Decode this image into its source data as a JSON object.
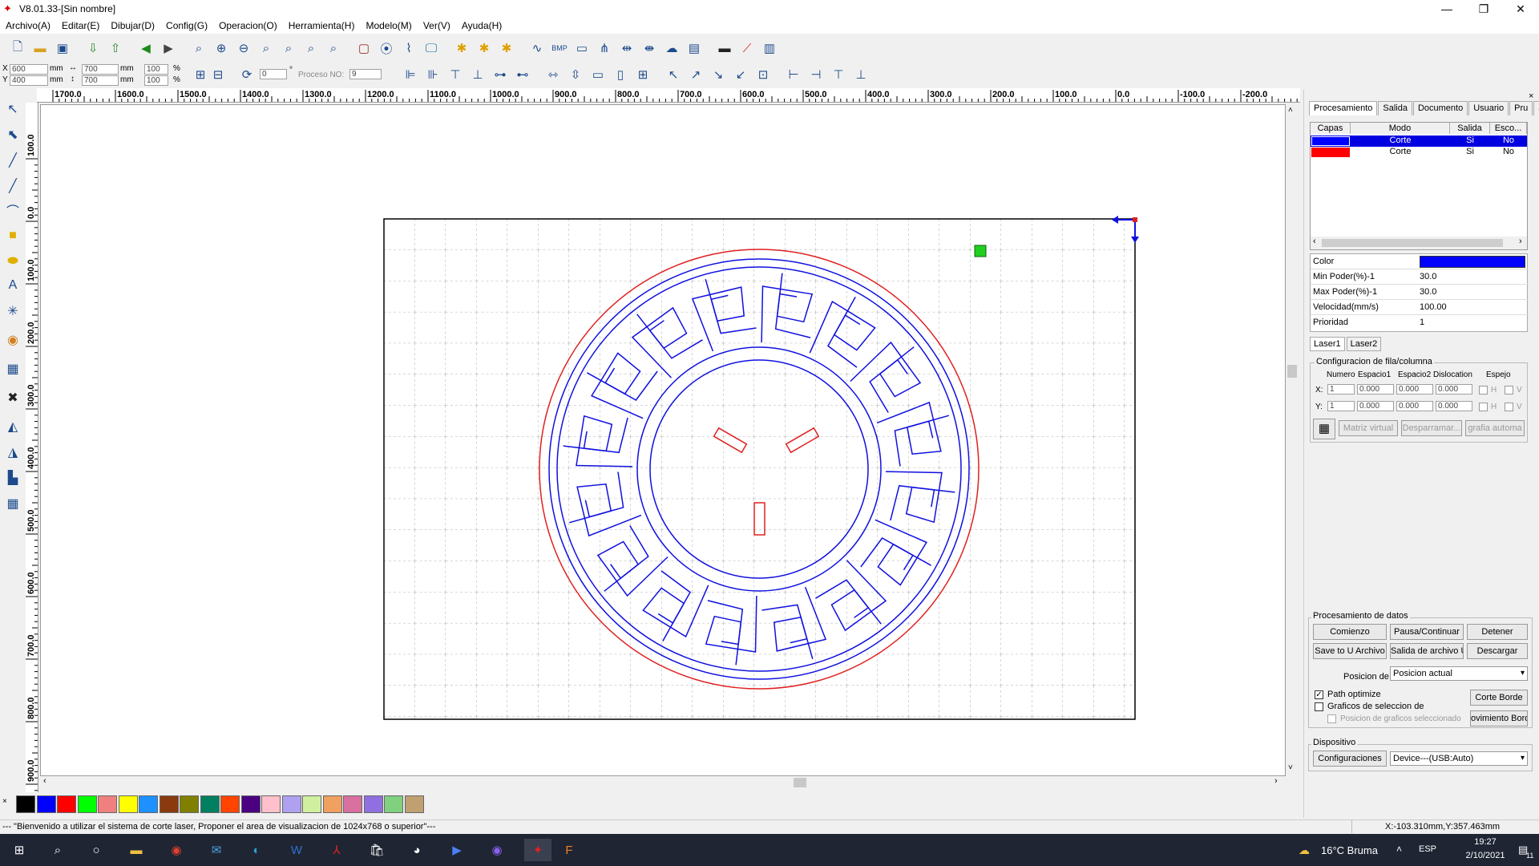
{
  "window": {
    "title": "V8.01.33-[Sin nombre]"
  },
  "menu": [
    "Archivo(A)",
    "Editar(E)",
    "Dibujar(D)",
    "Config(G)",
    "Operacion(O)",
    "Herramienta(H)",
    "Modelo(M)",
    "Ver(V)",
    "Ayuda(H)"
  ],
  "toolbar2": {
    "x": "600",
    "y": "400",
    "unit": "mm",
    "w": "700",
    "h": "700",
    "sx": "100",
    "sy": "100",
    "pct": "%",
    "rot": "0",
    "deg": "°",
    "proc_label": "Proceso NO:",
    "proc": "9"
  },
  "rulers": {
    "h": [
      "1700.0",
      "1600.0",
      "1500.0",
      "1400.0",
      "1300.0",
      "1200.0",
      "1100.0",
      "1000.0",
      "900.0",
      "800.0",
      "700.0",
      "600.0",
      "500.0",
      "400.0",
      "300.0",
      "200.0",
      "100.0",
      "0.0",
      "-100.0",
      "-200.0"
    ],
    "v": [
      "100.0",
      "0.0",
      "100.0",
      "200.0",
      "300.0",
      "400.0",
      "500.0",
      "600.0",
      "700.0",
      "800.0",
      "900.0"
    ]
  },
  "panel": {
    "tabs": [
      "Procesamiento",
      "Salida",
      "Documento",
      "Usuario",
      "Pru"
    ],
    "layer_headers": [
      "Capas",
      "Modo",
      "Salida",
      "Esco..."
    ],
    "layers": [
      {
        "color": "#0000ff",
        "mode": "Corte",
        "out": "Si",
        "esc": "No",
        "selected": true
      },
      {
        "color": "#ff0000",
        "mode": "Corte",
        "out": "Si",
        "esc": "No",
        "selected": false
      }
    ],
    "props": [
      {
        "k": "Color",
        "v": ""
      },
      {
        "k": "Min Poder(%)-1",
        "v": "30.0"
      },
      {
        "k": "Max Poder(%)-1",
        "v": "30.0"
      },
      {
        "k": "Velocidad(mm/s)",
        "v": "100.00"
      },
      {
        "k": "Prioridad",
        "v": "1"
      }
    ],
    "prop_color": "#0000ff",
    "laser_tabs": [
      "Laser1",
      "Laser2"
    ],
    "array": {
      "title": "Configuracion de fila/columna",
      "headers": [
        "Numero",
        "Espacio1",
        "Espacio2",
        "Dislocation",
        "Espejo"
      ],
      "x_label": "X:",
      "y_label": "Y:",
      "x": [
        "1",
        "0.000",
        "0.000",
        "0.000"
      ],
      "y": [
        "1",
        "0.000",
        "0.000",
        "0.000"
      ],
      "h": "H",
      "v": "V",
      "btns": [
        "Matriz virtual",
        "Desparramar...",
        "grafia automa"
      ]
    },
    "data": {
      "title": "Procesamiento de datos",
      "btns": [
        "Comienzo",
        "Pausa/Continuar",
        "Detener",
        "Save to U Archivo",
        "Salida de archivo U",
        "Descargar"
      ],
      "pos_label": "Posicion de",
      "pos_value": "Posicion actual",
      "path_opt": "Path optimize",
      "graf_sel": "Graficos de seleccion de",
      "pos_sel": "Posicion de graficos seleccionado",
      "corte_borde": "Corte Borde",
      "mov_borde": "ovimiento Bord"
    },
    "device": {
      "title": "Dispositivo",
      "cfg": "Configuraciones",
      "value": "Device---(USB:Auto)"
    }
  },
  "palette": [
    "#000000",
    "#0000ff",
    "#ff0000",
    "#00ff00",
    "#f08080",
    "#ffff00",
    "#1e90ff",
    "#8b3a0f",
    "#808000",
    "#008060",
    "#ff4500",
    "#4b0082",
    "#ffc0cb",
    "#b0a0f0",
    "#d0f0a0",
    "#f0a060",
    "#d870a0",
    "#9070e0",
    "#80d080",
    "#c0a070"
  ],
  "status": {
    "msg": "--- \"Bienvenido a utilizar el sistema de corte laser, Proponer el area de visualizacion de 1024x768 o superior\"---",
    "coords": "X:-103.310mm,Y:357.463mm"
  },
  "taskbar": {
    "weather": "16°C  Bruma",
    "lang": "ESP",
    "time": "19:27",
    "date": "2/10/2021",
    "notif": "11"
  }
}
